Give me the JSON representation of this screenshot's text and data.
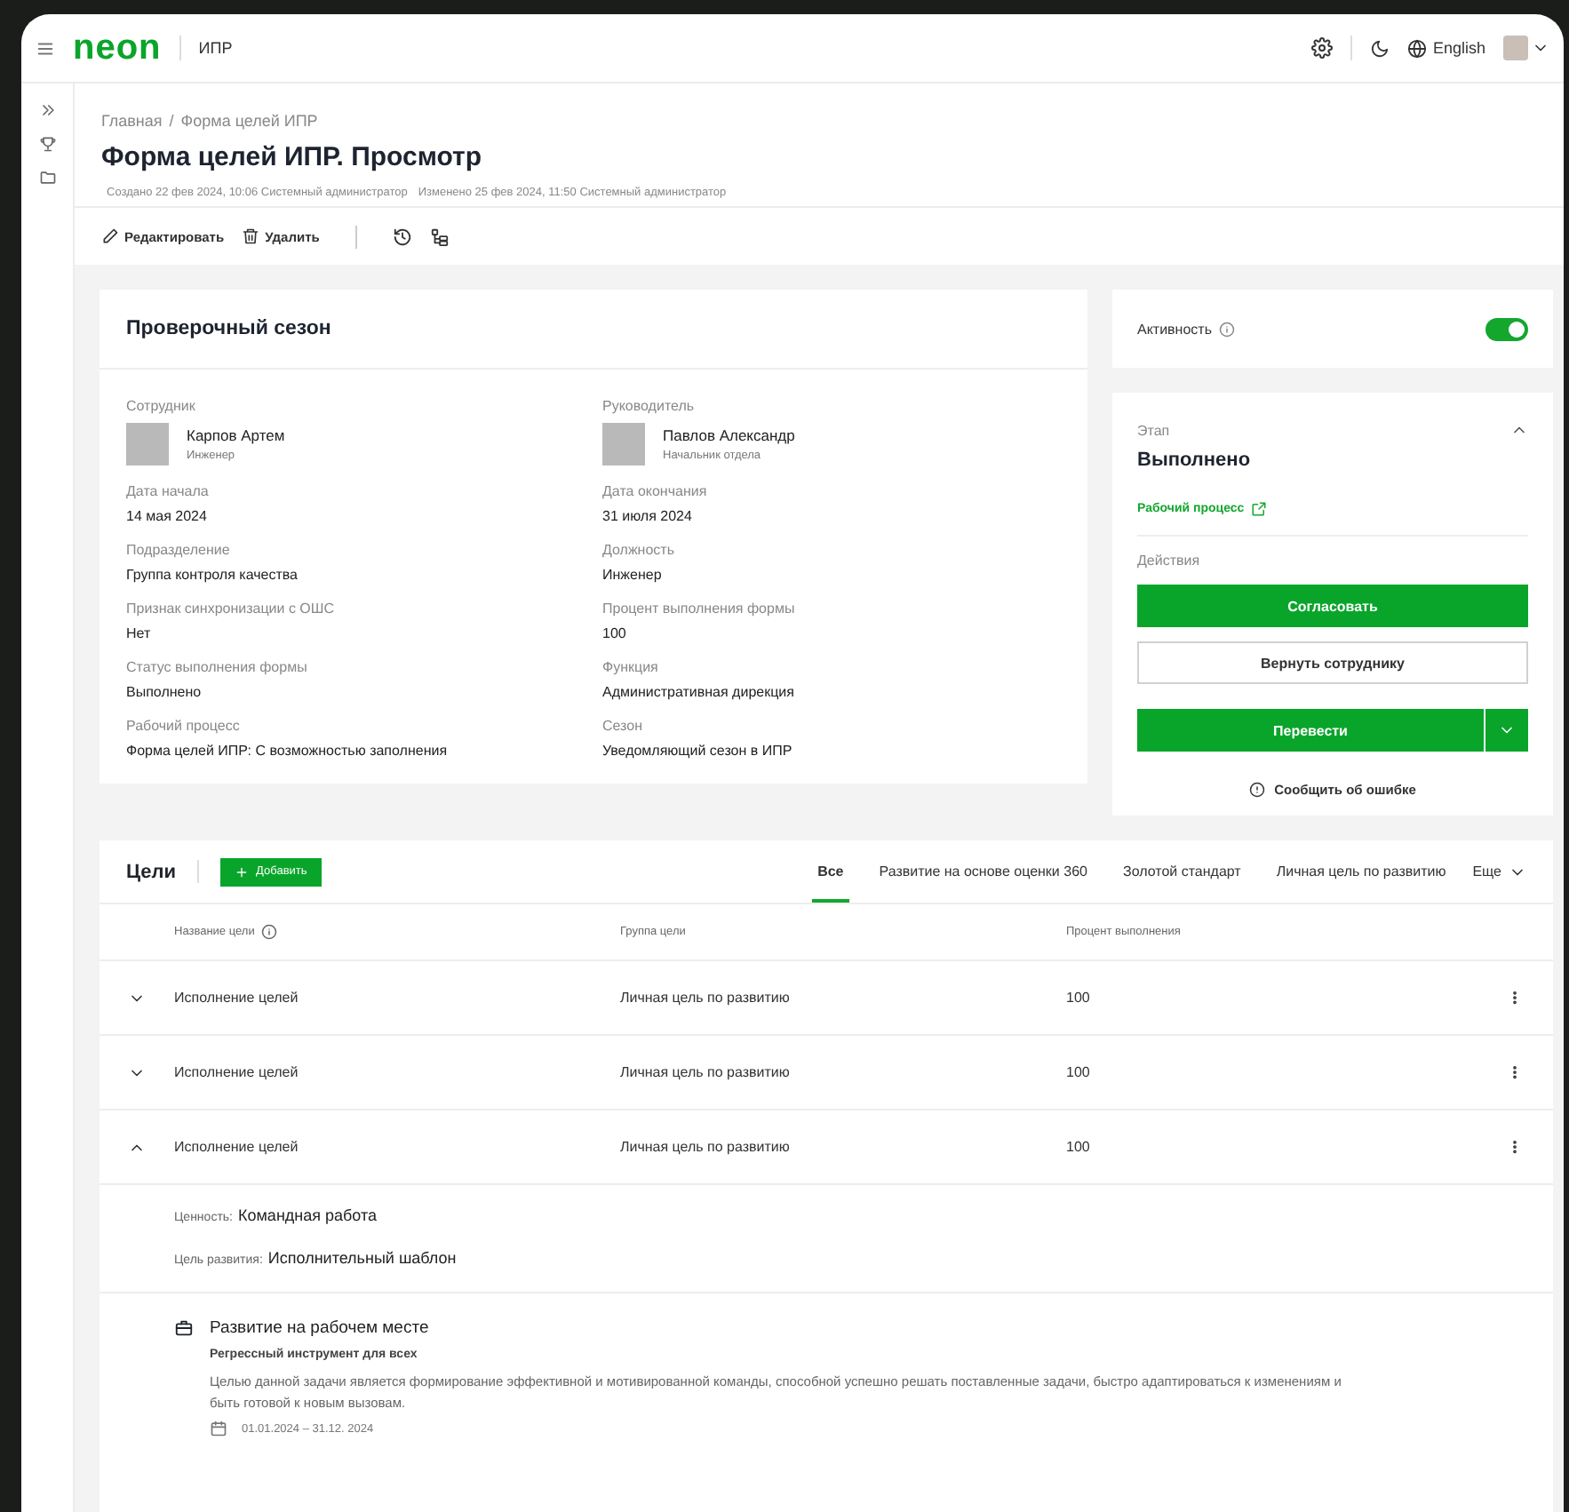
{
  "topbar": {
    "logo": "neon",
    "module": "ИПР",
    "language": "English"
  },
  "breadcrumbs": [
    "Главная",
    "Форма целей ИПР"
  ],
  "breadcrumb_separator": "/",
  "title": "Форма целей ИПР. Просмотр",
  "meta": [
    "Создано 22 фев 2024, 10:06 Системный администратор",
    "Изменено 25 фев 2024, 11:50 Системный администратор"
  ],
  "toolbar": [
    {
      "kind": "edit",
      "label": "Редактировать"
    },
    {
      "kind": "delete",
      "label": "Удалить"
    }
  ],
  "season_card": {
    "title": "Проверочный сезон",
    "fields": [
      {
        "kind": "person",
        "label": "Сотрудник",
        "name": "Карпов Артем",
        "role": "Инженер"
      },
      {
        "kind": "person",
        "label": "Руководитель",
        "name": "Павлов Александр",
        "role": "Начальник отдела"
      },
      {
        "kind": "text",
        "label": "Дата начала",
        "value": "14 мая 2024"
      },
      {
        "kind": "text",
        "label": "Дата окончания",
        "value": "31 июля 2024"
      },
      {
        "kind": "text",
        "label": "Подразделение",
        "value": "Группа контроля качества"
      },
      {
        "kind": "text",
        "label": "Должность",
        "value": "Инженер"
      },
      {
        "kind": "text",
        "label": "Признак синхронизации с ОШС",
        "value": "Нет"
      },
      {
        "kind": "text",
        "label": "Процент выполнения формы",
        "value": "100"
      },
      {
        "kind": "text",
        "label": "Статус выполнения формы",
        "value": "Выполнено"
      },
      {
        "kind": "text",
        "label": "Функция",
        "value": "Административная дирекция"
      },
      {
        "kind": "text",
        "label": "Рабочий процесс",
        "value": "Форма целей ИПР: С возможностью заполнения"
      },
      {
        "kind": "text",
        "label": "Сезон",
        "value": "Уведомляющий сезон в ИПР"
      }
    ]
  },
  "activity": {
    "label": "Активность",
    "on": true
  },
  "stage": {
    "label": "Этап",
    "value": "Выполнено",
    "expanded": true,
    "link": "Рабочий процесс",
    "actions_label": "Действия",
    "buttons": [
      {
        "kind": "primary",
        "label": "Согласовать"
      },
      {
        "kind": "outline",
        "label": "Вернуть сотруднику"
      },
      {
        "kind": "split",
        "label": "Перевести"
      }
    ],
    "report": "Сообщить об ошибке"
  },
  "goals": {
    "title": "Цели",
    "add": "Добавить",
    "tabs": [
      {
        "label": "Все",
        "selected": true
      },
      {
        "label": "Развитие на основе оценки 360",
        "selected": false
      },
      {
        "label": "Золотой стандарт",
        "selected": false
      },
      {
        "label": "Личная цель по развитию",
        "selected": false
      }
    ],
    "more": "Еще",
    "columns": [
      "Название цели",
      "Группа цели",
      "Процент выполнения"
    ],
    "rows": [
      {
        "name": "Исполнение целей",
        "group": "Личная цель по развитию",
        "percent": "100",
        "expanded": false
      },
      {
        "name": "Исполнение целей",
        "group": "Личная цель по развитию",
        "percent": "100",
        "expanded": false
      },
      {
        "name": "Исполнение целей",
        "group": "Личная цель по развитию",
        "percent": "100",
        "expanded": true,
        "details": {
          "props": [
            {
              "label": "Ценность:",
              "value": "Командная работа"
            },
            {
              "label": "Цель развития:",
              "value": "Исполнительный шаблон"
            }
          ],
          "task": {
            "title": "Развитие на рабочем месте",
            "subtitle": "Регрессный инструмент для всех",
            "description": "Целью данной задачи является формирование эффективной и мотивированной команды, способной успешно решать поставленные задачи, быстро адаптироваться к изменениям и быть готовой к новым вызовам.",
            "dates": "01.01.2024 – 31.12. 2024"
          }
        }
      }
    ]
  }
}
